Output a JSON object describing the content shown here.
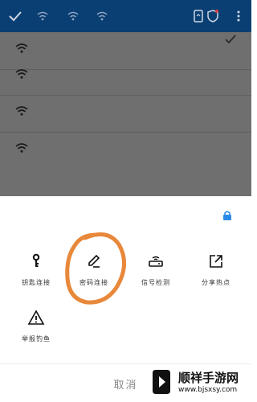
{
  "status_bar": {
    "bg_color": "#0a3f73",
    "icons": [
      "check-icon",
      "wifi-signal-icon",
      "wifi-signal-icon",
      "wifi-signal-icon",
      "phone-device-icon",
      "shield-icon",
      "more-vert-icon"
    ]
  },
  "wifi_list": {
    "rows": [
      {
        "icon": "wifi-icon"
      },
      {
        "icon": "wifi-icon"
      },
      {
        "icon": "wifi-icon"
      },
      {
        "icon": "wifi-icon"
      }
    ]
  },
  "sheet": {
    "lock_icon": "lock-icon",
    "actions": [
      {
        "label": "钥匙连接",
        "icon": "key-icon"
      },
      {
        "label": "密码连接",
        "icon": "pencil-icon"
      },
      {
        "label": "信号检测",
        "icon": "router-icon"
      },
      {
        "label": "分享热点",
        "icon": "share-external-icon"
      },
      {
        "label": "举报钓鱼",
        "icon": "warning-icon"
      }
    ],
    "cancel_label": "取消"
  },
  "annotation": {
    "color": "#e8883a"
  },
  "watermark": {
    "name": "顺祥手游网",
    "url": "www.bjsxsy.com"
  }
}
